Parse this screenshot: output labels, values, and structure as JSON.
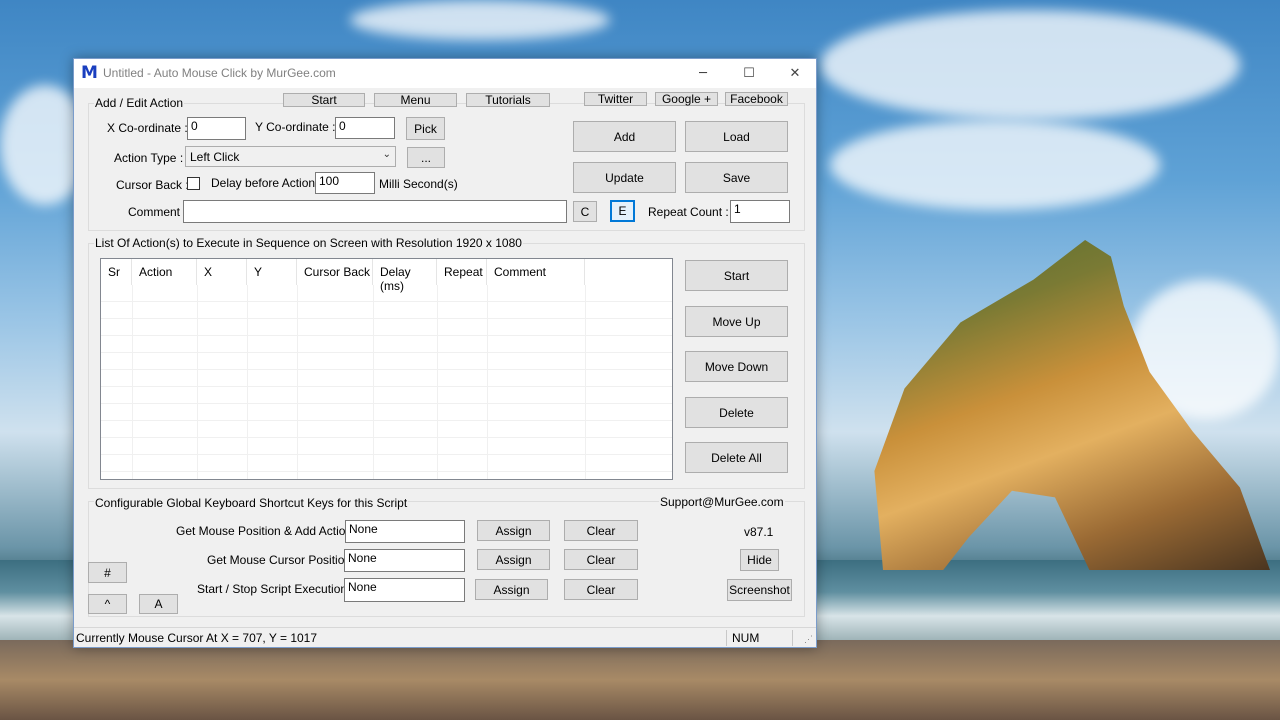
{
  "window": {
    "title": "Untitled - Auto Mouse Click by MurGee.com",
    "app_icon": "M",
    "minimize_glyph": "─",
    "maximize_glyph": "☐",
    "close_glyph": "✕"
  },
  "top_links": [
    "Start",
    "Menu",
    "Tutorials"
  ],
  "social_links": [
    "Twitter",
    "Google +",
    "Facebook"
  ],
  "edit_group": {
    "title": "Add / Edit Action",
    "x_label": "X Co-ordinate :",
    "x_value": "0",
    "y_label": "Y Co-ordinate :",
    "y_value": "0",
    "pick_button": "Pick",
    "action_type_label": "Action Type :",
    "action_type_value": "Left Click",
    "more_button": "...",
    "cursor_back_label": "Cursor Back :",
    "cursor_back_checked": false,
    "delay_label": "Delay before Action :",
    "delay_value": "100",
    "delay_unit": "Milli Second(s)",
    "comment_label": "Comment :",
    "comment_value": "",
    "c_button": "C",
    "e_button": "E",
    "repeat_label": "Repeat Count :",
    "repeat_value": "1"
  },
  "right_buttons": {
    "add": "Add",
    "load": "Load",
    "update": "Update",
    "save": "Save"
  },
  "list_group": {
    "title": "List Of Action(s) to Execute in Sequence on Screen with Resolution 1920 x 1080",
    "columns": [
      "Sr",
      "Action",
      "X",
      "Y",
      "Cursor Back",
      "Delay (ms)",
      "Repeat",
      "Comment"
    ],
    "rows": []
  },
  "list_buttons": {
    "start": "Start",
    "move_up": "Move Up",
    "move_down": "Move Down",
    "delete": "Delete",
    "delete_all": "Delete All"
  },
  "shortcut_group": {
    "title": "Configurable Global Keyboard Shortcut Keys for this Script",
    "support": "Support@MurGee.com",
    "version": "v87.1",
    "rows": [
      {
        "label": "Get Mouse Position & Add Action :",
        "value": "None",
        "assign": "Assign",
        "clear": "Clear"
      },
      {
        "label": "Get Mouse Cursor Position :",
        "value": "None",
        "assign": "Assign",
        "clear": "Clear"
      },
      {
        "label": "Start / Stop Script Execution :",
        "value": "None",
        "assign": "Assign",
        "clear": "Clear"
      }
    ],
    "hash_button": "#",
    "caret_button": "^",
    "a_button": "A",
    "hide_button": "Hide",
    "screenshot_button": "Screenshot"
  },
  "statusbar": {
    "text": "Currently Mouse Cursor At X = 707, Y = 1017",
    "num": "NUM"
  }
}
